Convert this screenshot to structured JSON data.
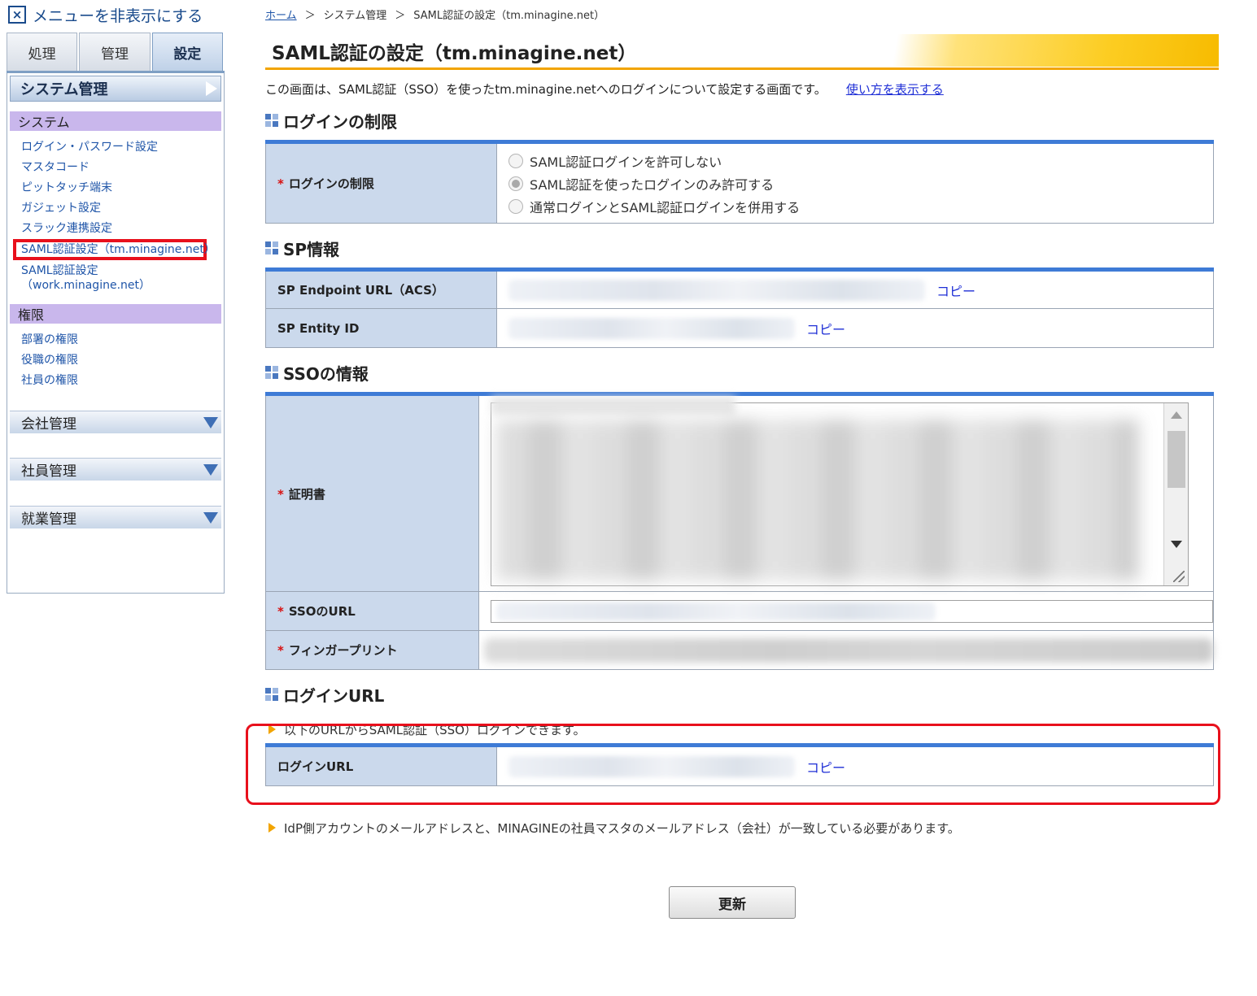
{
  "sidebar": {
    "hide_menu_label": "メニューを非表示にする",
    "tabs": [
      {
        "label": "処理"
      },
      {
        "label": "管理"
      },
      {
        "label": "設定"
      }
    ],
    "system_header": "システム管理",
    "system_category": "システム",
    "system_links": [
      "ログイン・パスワード設定",
      "マスタコード",
      "ピットタッチ端末",
      "ガジェット設定",
      "スラック連携設定",
      "SAML認証設定（tm.minagine.net）",
      "SAML認証設定（work.minagine.net）"
    ],
    "permissions_category": "権限",
    "permission_links": [
      "部署の権限",
      "役職の権限",
      "社員の権限"
    ],
    "sections": [
      "会社管理",
      "社員管理",
      "就業管理"
    ]
  },
  "breadcrumb": {
    "home": "ホーム",
    "sep": "＞",
    "level1": "システム管理",
    "current": "SAML認証の設定（tm.minagine.net）"
  },
  "page": {
    "title": "SAML認証の設定（tm.minagine.net）",
    "intro": "この画面は、SAML認証（SSO）を使ったtm.minagine.netへのログインについて設定する画面です。",
    "help_link": "使い方を表示する"
  },
  "login_restriction": {
    "section_title": "ログインの制限",
    "field_label": "ログインの制限",
    "options": [
      {
        "label": "SAML認証ログインを許可しない",
        "selected": false
      },
      {
        "label": "SAML認証を使ったログインのみ許可する",
        "selected": true
      },
      {
        "label": "通常ログインとSAML認証ログインを併用する",
        "selected": false
      }
    ]
  },
  "sp_info": {
    "section_title": "SP情報",
    "rows": [
      {
        "label": "SP Endpoint URL（ACS）",
        "copy": "コピー"
      },
      {
        "label": "SP Entity ID",
        "copy": "コピー"
      }
    ]
  },
  "sso_info": {
    "section_title": "SSOの情報",
    "certificate_label": "証明書",
    "sso_url_label": "SSOのURL",
    "fingerprint_label": "フィンガープリント"
  },
  "login_url": {
    "section_title": "ログインURL",
    "note": "以下のURLからSAML認証（SSO）ログインできます。",
    "field_label": "ログインURL",
    "copy": "コピー"
  },
  "footer_note": "IdP側アカウントのメールアドレスと、MINAGINEの社員マスタのメールアドレス（会社）が一致している必要があります。",
  "buttons": {
    "update": "更新"
  },
  "colors": {
    "accent_blue": "#3e7bd6",
    "label_bg": "#cbd9ec",
    "highlight_red": "#e8101c",
    "title_orange": "#f2a400",
    "category_purple": "#c9b7ec"
  }
}
